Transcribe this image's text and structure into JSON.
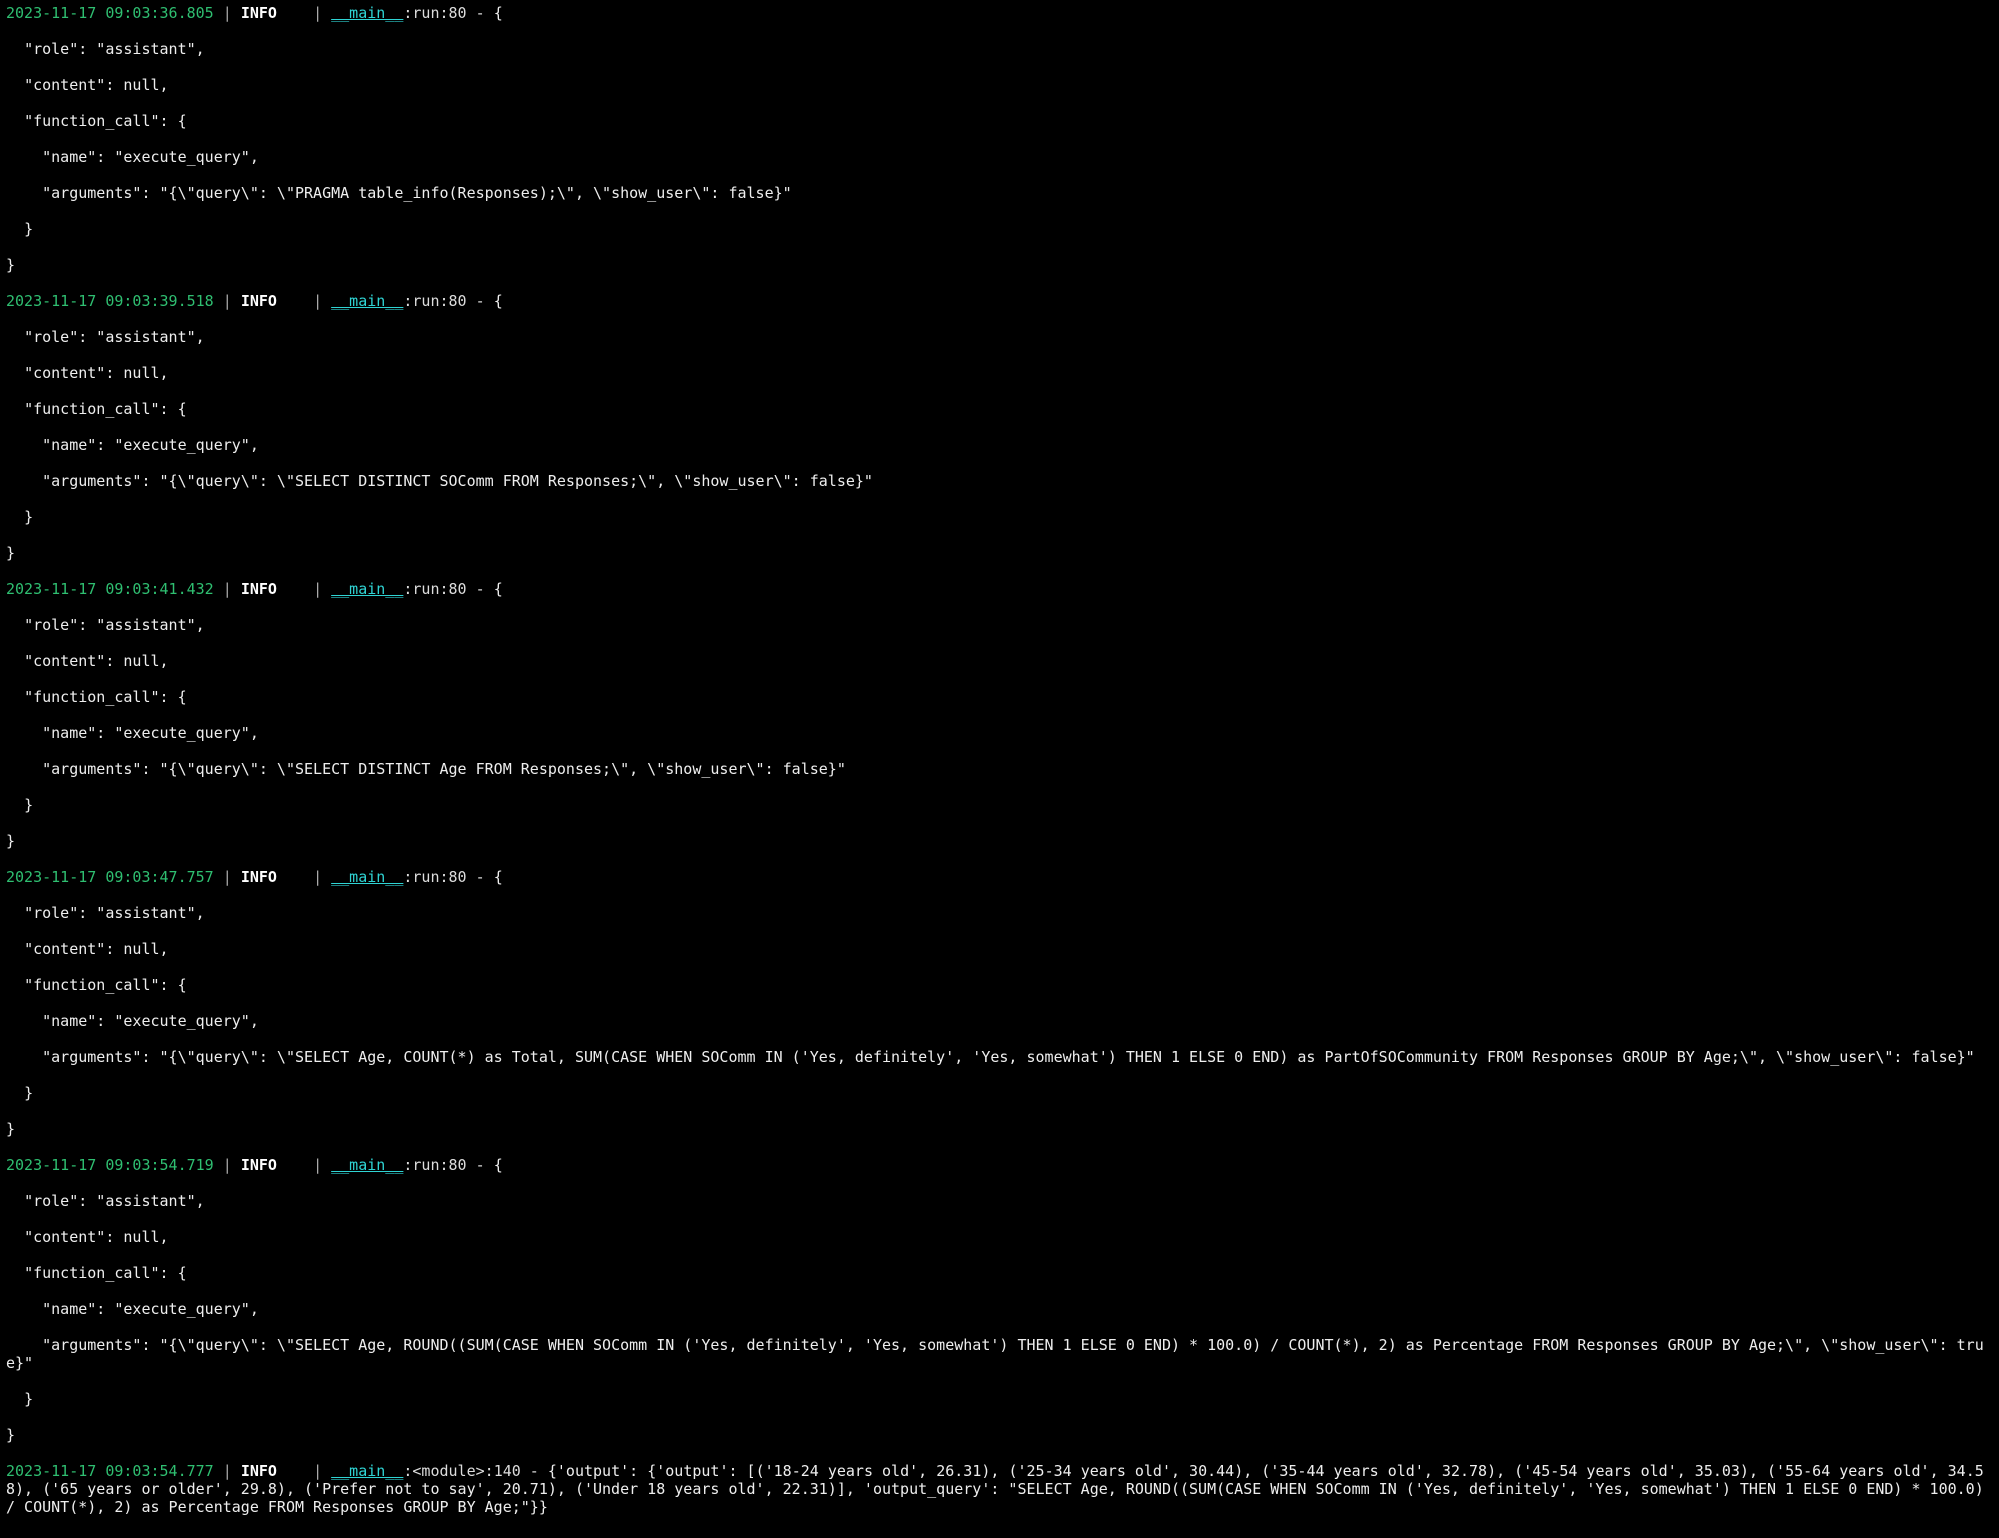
{
  "entries": [
    {
      "ts": "2023-11-17 09:03:36.805",
      "level": "INFO",
      "module": "__main__",
      "func": "run",
      "lineno": "80",
      "body_lines": [
        "{",
        "  \"role\": \"assistant\",",
        "  \"content\": null,",
        "  \"function_call\": {",
        "    \"name\": \"execute_query\",",
        "    \"arguments\": \"{\\\"query\\\": \\\"PRAGMA table_info(Responses);\\\", \\\"show_user\\\": false}\"",
        "  }",
        "}"
      ]
    },
    {
      "ts": "2023-11-17 09:03:39.518",
      "level": "INFO",
      "module": "__main__",
      "func": "run",
      "lineno": "80",
      "body_lines": [
        "{",
        "  \"role\": \"assistant\",",
        "  \"content\": null,",
        "  \"function_call\": {",
        "    \"name\": \"execute_query\",",
        "    \"arguments\": \"{\\\"query\\\": \\\"SELECT DISTINCT SOComm FROM Responses;\\\", \\\"show_user\\\": false}\"",
        "  }",
        "}"
      ]
    },
    {
      "ts": "2023-11-17 09:03:41.432",
      "level": "INFO",
      "module": "__main__",
      "func": "run",
      "lineno": "80",
      "body_lines": [
        "{",
        "  \"role\": \"assistant\",",
        "  \"content\": null,",
        "  \"function_call\": {",
        "    \"name\": \"execute_query\",",
        "    \"arguments\": \"{\\\"query\\\": \\\"SELECT DISTINCT Age FROM Responses;\\\", \\\"show_user\\\": false}\"",
        "  }",
        "}"
      ]
    },
    {
      "ts": "2023-11-17 09:03:47.757",
      "level": "INFO",
      "module": "__main__",
      "func": "run",
      "lineno": "80",
      "body_lines": [
        "{",
        "  \"role\": \"assistant\",",
        "  \"content\": null,",
        "  \"function_call\": {",
        "    \"name\": \"execute_query\",",
        "    \"arguments\": \"{\\\"query\\\": \\\"SELECT Age, COUNT(*) as Total, SUM(CASE WHEN SOComm IN ('Yes, definitely', 'Yes, somewhat') THEN 1 ELSE 0 END) as PartOfSOCommunity FROM Responses GROUP BY Age;\\\", \\\"show_user\\\": false}\"",
        "  }",
        "}"
      ]
    },
    {
      "ts": "2023-11-17 09:03:54.719",
      "level": "INFO",
      "module": "__main__",
      "func": "run",
      "lineno": "80",
      "body_lines": [
        "{",
        "  \"role\": \"assistant\",",
        "  \"content\": null,",
        "  \"function_call\": {",
        "    \"name\": \"execute_query\",",
        "    \"arguments\": \"{\\\"query\\\": \\\"SELECT Age, ROUND((SUM(CASE WHEN SOComm IN ('Yes, definitely', 'Yes, somewhat') THEN 1 ELSE 0 END) * 100.0) / COUNT(*), 2) as Percentage FROM Responses GROUP BY Age;\\\", \\\"show_user\\\": true}\"",
        "  }",
        "}"
      ]
    },
    {
      "ts": "2023-11-17 09:03:54.777",
      "level": "INFO",
      "module": "__main__",
      "func": "<module>",
      "lineno": "140",
      "body_lines": [
        "{'output': {'output': [('18-24 years old', 26.31), ('25-34 years old', 30.44), ('35-44 years old', 32.78), ('45-54 years old', 35.03), ('55-64 years old', 34.58), ('65 years or older', 29.8), ('Prefer not to say', 20.71), ('Under 18 years old', 22.31)], 'output_query': \"SELECT Age, ROUND((SUM(CASE WHEN SOComm IN ('Yes, definitely', 'Yes, somewhat') THEN 1 ELSE 0 END) * 100.0) / COUNT(*), 2) as Percentage FROM Responses GROUP BY Age;\"}}"
      ]
    }
  ],
  "level_pad": "INFO    "
}
